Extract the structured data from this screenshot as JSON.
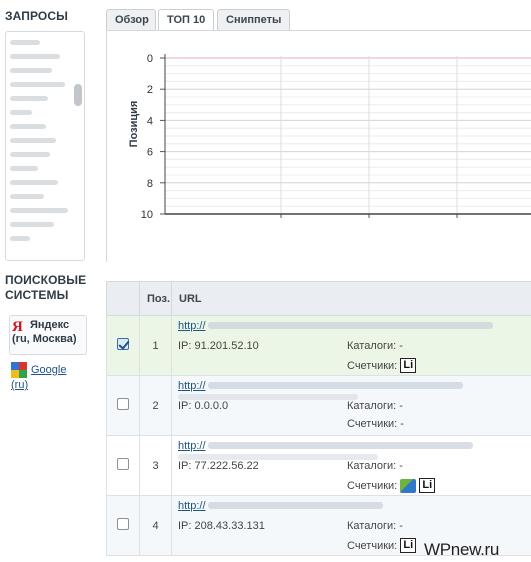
{
  "sidebar": {
    "queries_title": "ЗАПРОСЫ",
    "engines_title": "ПОИСКОВЫЕ СИСТЕМЫ",
    "engines": [
      {
        "name": "Яндекс",
        "region": "(ru, Москва)",
        "icon": "yandex-icon",
        "selected": true
      },
      {
        "name": "Google",
        "region": "(ru)",
        "icon": "google-icon",
        "selected": false
      }
    ]
  },
  "tabs": [
    {
      "label": "Обзор",
      "active": false
    },
    {
      "label": "ТОП 10",
      "active": true
    },
    {
      "label": "Сниппеты",
      "active": false
    }
  ],
  "chart_data": {
    "type": "line",
    "ylabel": "Позиция",
    "yticks": [
      "0",
      "2",
      "4",
      "6",
      "8",
      "10"
    ],
    "ylim": [
      0,
      10
    ],
    "y_inverted": true,
    "grid": true,
    "series": []
  },
  "table": {
    "columns": [
      "",
      "Поз.",
      "URL"
    ],
    "url_prefix": "http://",
    "ip_label": "IP:",
    "catalogs_label": "Каталоги:",
    "counters_label": "Счетчики:",
    "rows": [
      {
        "checked": true,
        "position": "1",
        "ip": "91.201.52.10",
        "catalogs": "-",
        "counters": "Li",
        "counter_icons": [
          "li-icon"
        ]
      },
      {
        "checked": false,
        "position": "2",
        "ip": "0.0.0.0",
        "catalogs": "-",
        "counters": "-",
        "counter_icons": []
      },
      {
        "checked": false,
        "position": "3",
        "ip": "77.222.56.22",
        "catalogs": "-",
        "counters": "Li",
        "counter_icons": [
          "counter-icon",
          "li-icon"
        ]
      },
      {
        "checked": false,
        "position": "4",
        "ip": "208.43.33.131",
        "catalogs": "-",
        "counters": "Li",
        "counter_icons": [
          "li-icon"
        ]
      }
    ]
  },
  "watermark": "WPnew.ru",
  "colors": {
    "selected_row": "#ecf6e7",
    "link": "#20558a",
    "header_bg": "#eaeef2",
    "yandex_red": "#d3141b"
  }
}
